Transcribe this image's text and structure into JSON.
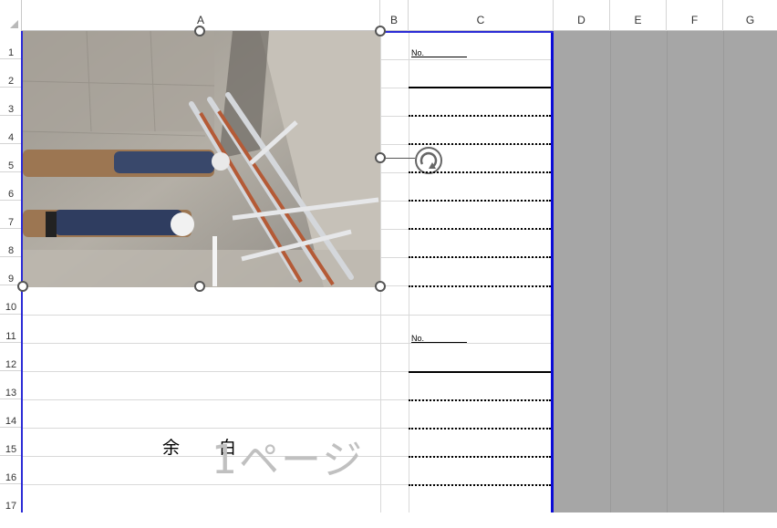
{
  "columns": [
    "A",
    "B",
    "C",
    "D",
    "E",
    "F",
    "G"
  ],
  "rows": [
    "1",
    "2",
    "3",
    "4",
    "5",
    "6",
    "7",
    "8",
    "9",
    "10",
    "11",
    "12",
    "13",
    "14",
    "15",
    "16",
    "17"
  ],
  "blocks": [
    {
      "no_label": "No."
    },
    {
      "no_label": "No."
    }
  ],
  "margin_text": {
    "left": "余",
    "right": "白"
  },
  "page_watermark": "1ページ",
  "colors": {
    "page_break_border": "#0b0bd6",
    "outside_print_area": "#a6a6a6",
    "gridline": "#d9d9d9"
  }
}
